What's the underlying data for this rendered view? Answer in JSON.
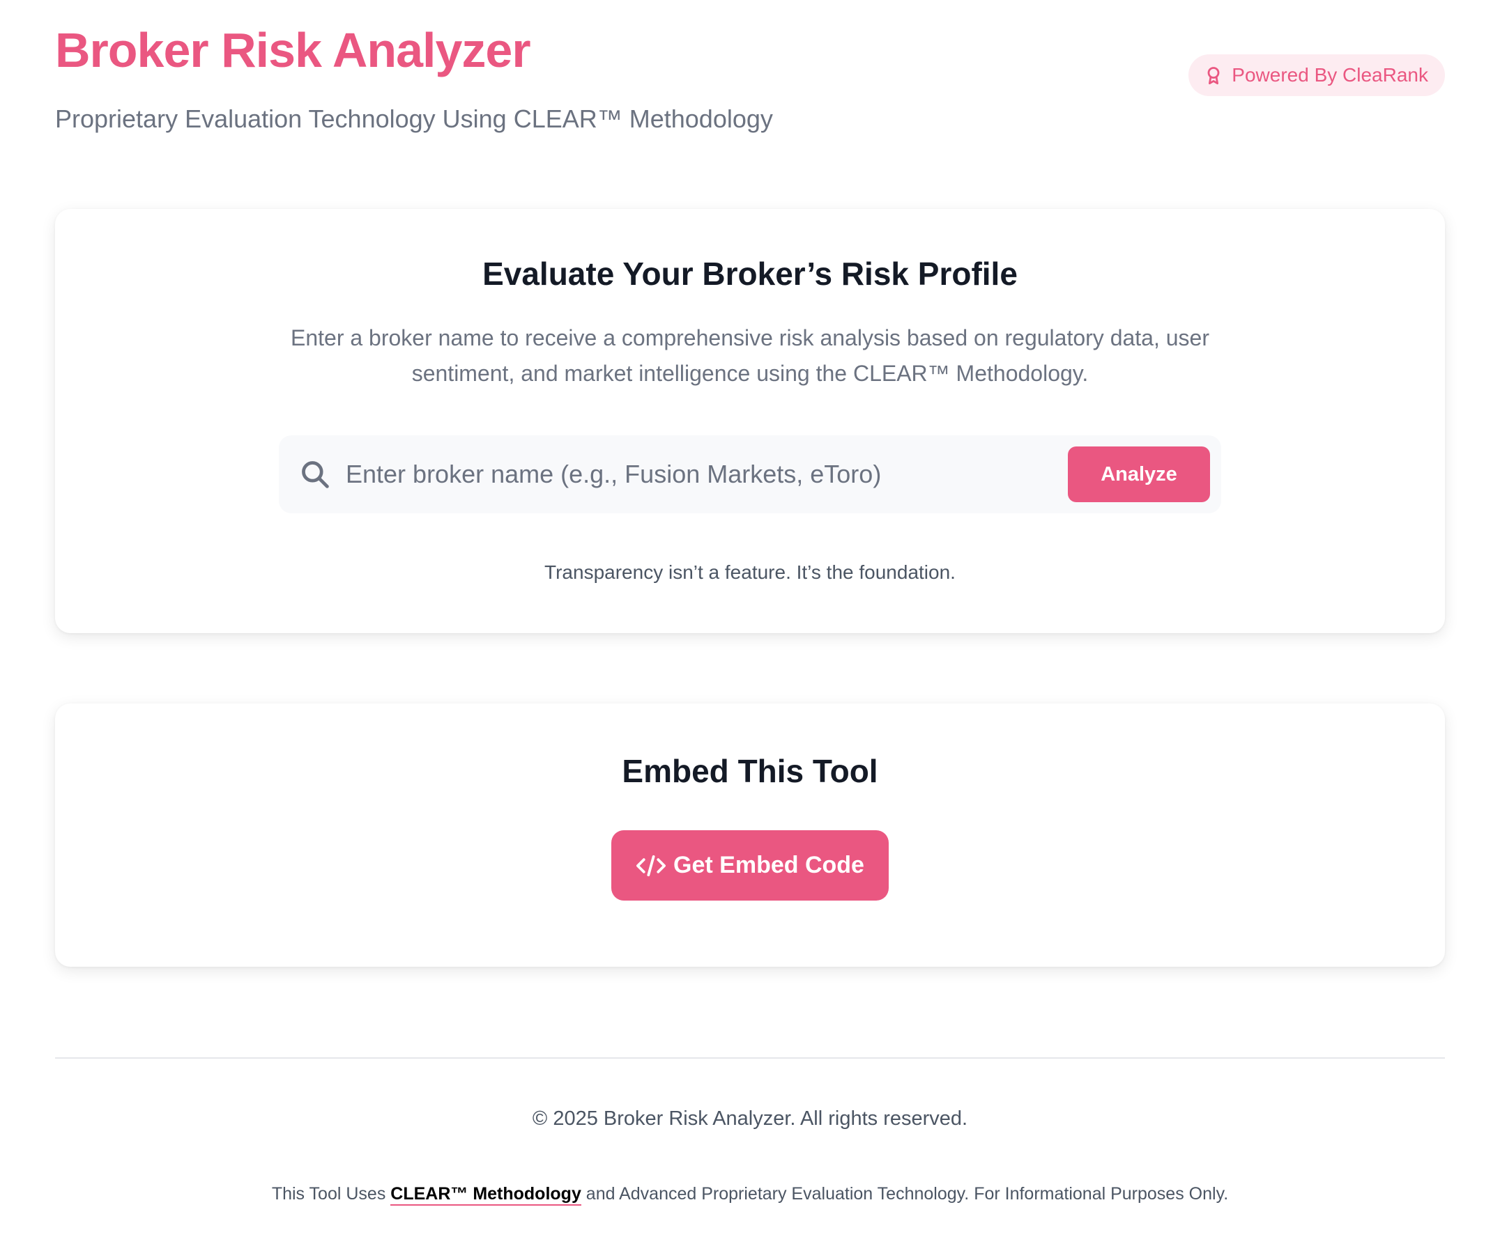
{
  "header": {
    "title": "Broker Risk Analyzer",
    "subtitle": "Proprietary Evaluation Technology Using CLEAR™ Methodology",
    "badge_label": "Powered By CleaRank",
    "badge_icon": "award-icon"
  },
  "evaluate": {
    "heading": "Evaluate Your Broker’s Risk Profile",
    "description": "Enter a broker name to receive a comprehensive risk analysis based on regulatory data, user sentiment, and market intelligence using the CLEAR™ Methodology.",
    "search": {
      "icon": "search-icon",
      "value": "",
      "placeholder": "Enter broker name (e.g., Fusion Markets, eToro)"
    },
    "analyze_label": "Analyze",
    "tagline": "Transparency isn’t a feature. It’s the foundation."
  },
  "embed": {
    "heading": "Embed This Tool",
    "button_icon": "code-icon",
    "button_label": "Get Embed Code"
  },
  "footer": {
    "copyright": "© 2025 Broker Risk Analyzer. All rights reserved.",
    "disclaimer_prefix": "This Tool Uses ",
    "disclaimer_link": "CLEAR™ Methodology",
    "disclaimer_suffix": " and Advanced Proprietary Evaluation Technology. For Informational Purposes Only."
  },
  "colors": {
    "accent": "#ea5781",
    "badge_background": "#fdecf1",
    "heading_text": "#141a26",
    "muted_text": "#6b7280",
    "search_background": "#f8f9fb"
  }
}
